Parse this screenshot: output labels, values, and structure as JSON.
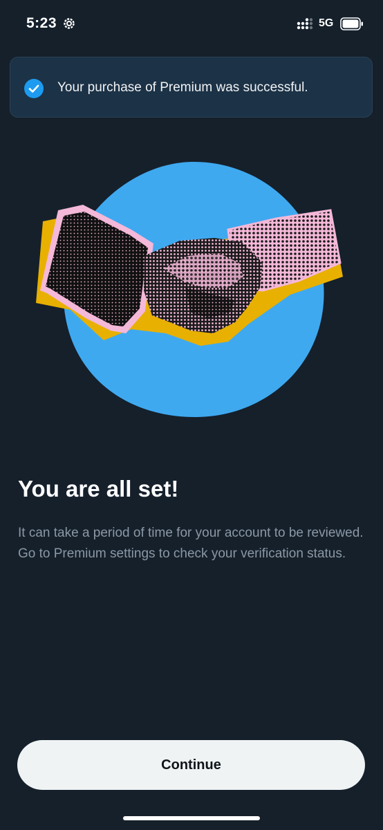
{
  "status_bar": {
    "time": "5:23",
    "network": "5G",
    "icons": [
      "gear-icon",
      "signal-icon",
      "battery-icon"
    ]
  },
  "toast": {
    "message": "Your purchase of Premium was successful.",
    "icon": "check-circle-icon",
    "icon_color": "#1d9bf0"
  },
  "illustration": {
    "name": "handshake-illustration",
    "circle_color": "#3fa9f0",
    "accent_pink": "#f4b8d8",
    "accent_yellow": "#e8b000"
  },
  "content": {
    "headline": "You are all set!",
    "body": "It can take a period of time for your account to be reviewed. Go to Premium settings to check your verification status."
  },
  "actions": {
    "continue_label": "Continue"
  },
  "colors": {
    "background": "#15202b",
    "toast_background": "#1c3246",
    "secondary_text": "#8b98a5",
    "button_background": "#eff3f4",
    "button_text": "#0f1419"
  }
}
